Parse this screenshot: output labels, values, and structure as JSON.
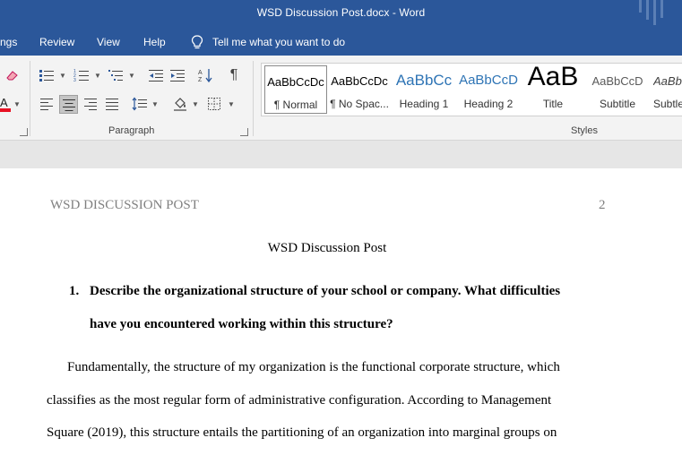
{
  "window": {
    "title": "WSD Discussion Post.docx  -  Word"
  },
  "tabs": [
    {
      "label": "ngs"
    },
    {
      "label": "Review"
    },
    {
      "label": "View"
    },
    {
      "label": "Help"
    }
  ],
  "tell_me": {
    "text": "Tell me what you want to do"
  },
  "ribbon": {
    "paragraph_group_label": "Paragraph",
    "styles_group_label": "Styles",
    "font_color": "#e81123",
    "styles": [
      {
        "preview": "AaBbCcDc",
        "name": "¶ Normal",
        "selected": true
      },
      {
        "preview": "AaBbCcDc",
        "name": "¶ No Spac...",
        "selected": false
      },
      {
        "preview": "AaBbCc",
        "name": "Heading 1",
        "selected": false
      },
      {
        "preview": "AaBbCcD",
        "name": "Heading 2",
        "selected": false
      },
      {
        "preview": "AaB",
        "name": "Title",
        "selected": false
      },
      {
        "preview": "AaBbCcD",
        "name": "Subtitle",
        "selected": false
      },
      {
        "preview": "AaBbCcl",
        "name": "Subtle",
        "selected": false
      }
    ]
  },
  "document": {
    "header_left": "WSD DISCUSSION POST",
    "page_number": "2",
    "title": "WSD Discussion Post",
    "question_number": "1.",
    "question_lines": [
      "Describe the organizational structure of your school or company. What difficulties",
      "have you encountered working within this structure?"
    ],
    "body_lines": [
      "Fundamentally, the structure of my organization is the functional corporate structure, which",
      "classifies as the most regular form of administrative configuration. According to Management",
      "Square (2019), this structure entails the partitioning of an organization into marginal groups on"
    ]
  },
  "colors": {
    "title_bar": "#2b579a",
    "ribbon_bg": "#f3f3f3",
    "heading_style_blue": "#2e74b5"
  }
}
